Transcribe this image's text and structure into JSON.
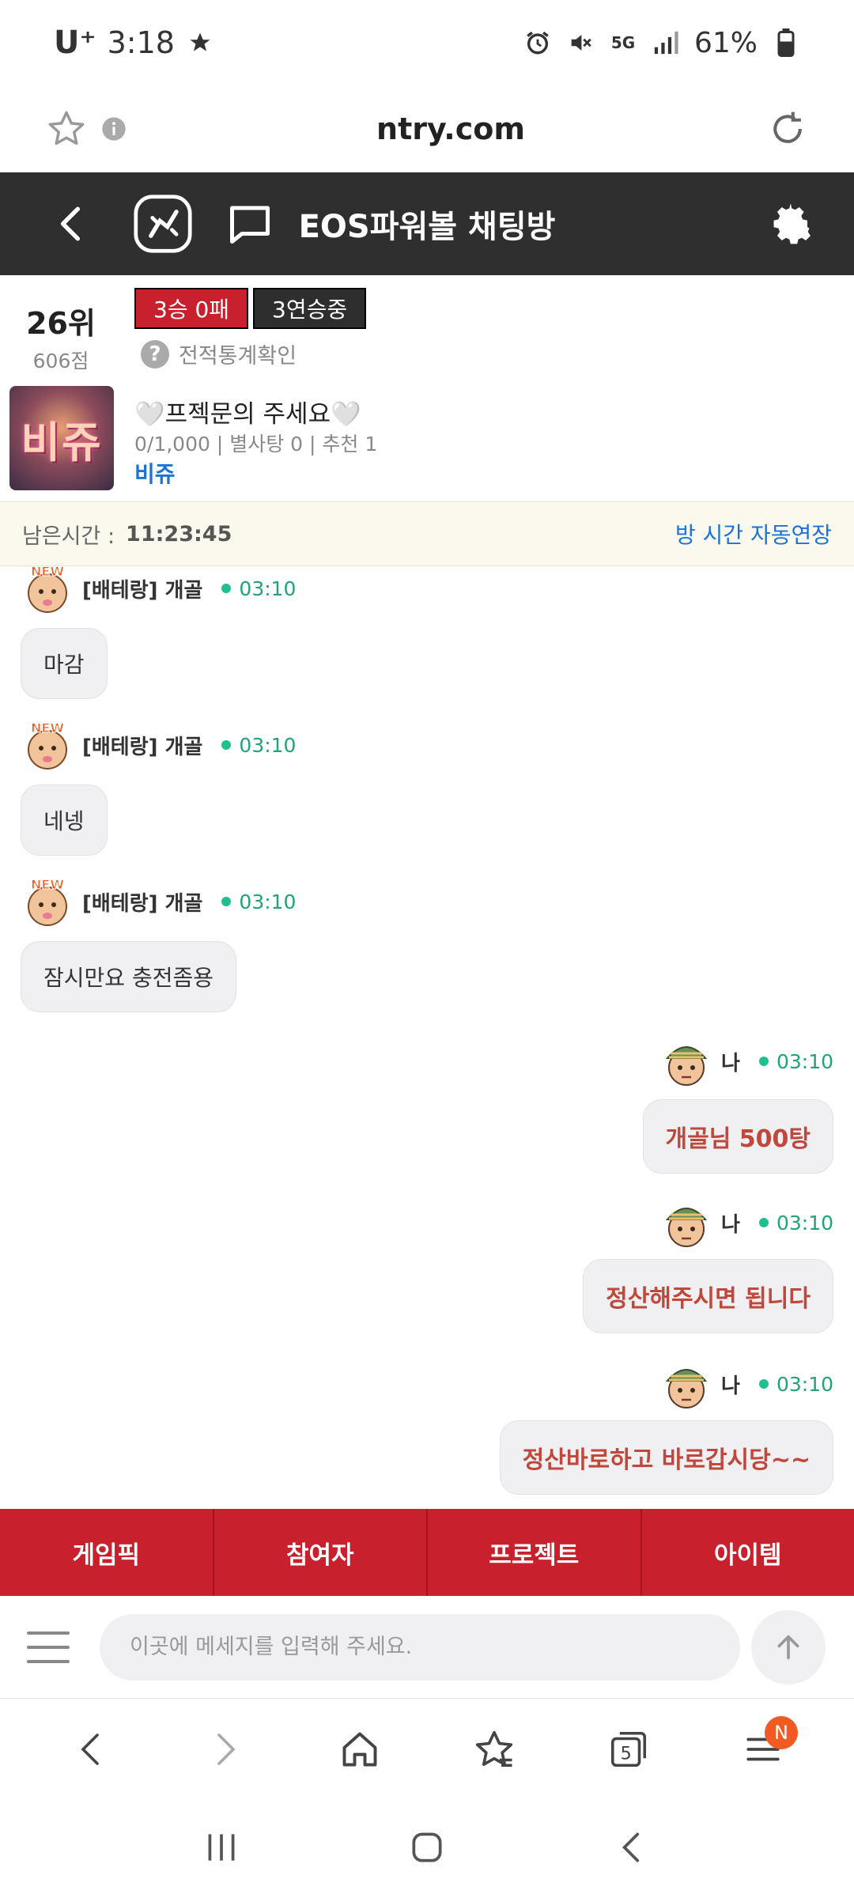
{
  "status_bar": {
    "carrier": "U⁺",
    "time": "3:18",
    "battery": "61%",
    "network": "5G"
  },
  "browser": {
    "url": "ntry.com"
  },
  "header": {
    "title": "EOS파워볼 채팅방"
  },
  "room": {
    "rank": "26위",
    "points": "606점",
    "record_badge": "3승 0패",
    "streak_badge": "3연승중",
    "stats_link": "전적통계확인",
    "thumbnail_text": "비쥬",
    "name": "🤍프젝문의 주세요🤍",
    "meta": "0/1,000 | 별사탕 0 | 추천 1",
    "owner": "비쥬"
  },
  "timer": {
    "label": "남은시간 :",
    "value": "11:23:45",
    "extend": "방 시간 자동연장"
  },
  "messages": [
    {
      "user": "[배테랑] 개골",
      "time": "03:10",
      "text": "마감",
      "mine": false
    },
    {
      "user": "[배테랑] 개골",
      "time": "03:10",
      "text": "네넹",
      "mine": false
    },
    {
      "user": "[배테랑] 개골",
      "time": "03:10",
      "text": "잠시만요 충전좀용",
      "mine": false
    },
    {
      "user": "나",
      "time": "03:10",
      "text": "개골님 500탕",
      "mine": true
    },
    {
      "user": "나",
      "time": "03:10",
      "text": "정산해주시면 됩니다",
      "mine": true
    },
    {
      "user": "나",
      "time": "03:10",
      "text": "정산바로하고 바로갑시당~~",
      "mine": true
    }
  ],
  "avatar_label": "NEW",
  "tabs": [
    "게임픽",
    "참여자",
    "프로젝트",
    "아이템"
  ],
  "input": {
    "placeholder": "이곳에 메세지를 입력해 주세요."
  },
  "browser_nav": {
    "tabs_count": "5",
    "menu_badge": "N"
  },
  "colors": {
    "accent": "#c8202c",
    "header_bg": "#2f2f2f",
    "link": "#1a73d9",
    "time": "#1fa27d",
    "my_text": "#c0473c"
  }
}
